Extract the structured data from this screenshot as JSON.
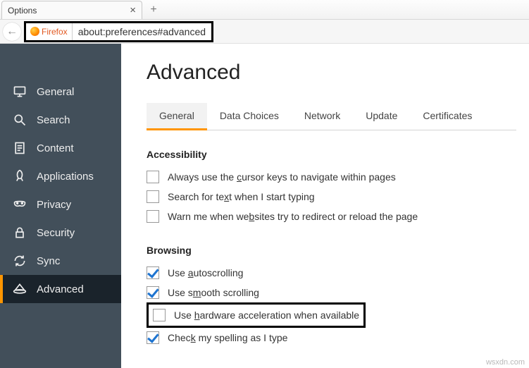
{
  "tab": {
    "title": "Options"
  },
  "urlbar": {
    "badge": "Firefox",
    "url": "about:preferences#advanced"
  },
  "sidebar": {
    "items": [
      {
        "label": "General"
      },
      {
        "label": "Search"
      },
      {
        "label": "Content"
      },
      {
        "label": "Applications"
      },
      {
        "label": "Privacy"
      },
      {
        "label": "Security"
      },
      {
        "label": "Sync"
      },
      {
        "label": "Advanced"
      }
    ]
  },
  "page": {
    "title": "Advanced",
    "subtabs": [
      {
        "label": "General"
      },
      {
        "label": "Data Choices"
      },
      {
        "label": "Network"
      },
      {
        "label": "Update"
      },
      {
        "label": "Certificates"
      }
    ],
    "accessibility": {
      "title": "Accessibility",
      "opts": [
        {
          "label_pre": "Always use the ",
          "u": "c",
          "label_post": "ursor keys to navigate within pages",
          "checked": false
        },
        {
          "label_pre": "Search for te",
          "u": "x",
          "label_post": "t when I start typing",
          "checked": false
        },
        {
          "label_pre": "Warn me when we",
          "u": "b",
          "label_post": "sites try to redirect or reload the page",
          "checked": false
        }
      ]
    },
    "browsing": {
      "title": "Browsing",
      "opts": [
        {
          "label_pre": "Use ",
          "u": "a",
          "label_post": "utoscrolling",
          "checked": true
        },
        {
          "label_pre": "Use s",
          "u": "m",
          "label_post": "ooth scrolling",
          "checked": true
        },
        {
          "label_pre": "Use ",
          "u": "h",
          "label_post": "ardware acceleration when available",
          "checked": false
        },
        {
          "label_pre": "Chec",
          "u": "k",
          "label_post": " my spelling as I type",
          "checked": true
        }
      ]
    }
  },
  "watermark": "wsxdn.com"
}
